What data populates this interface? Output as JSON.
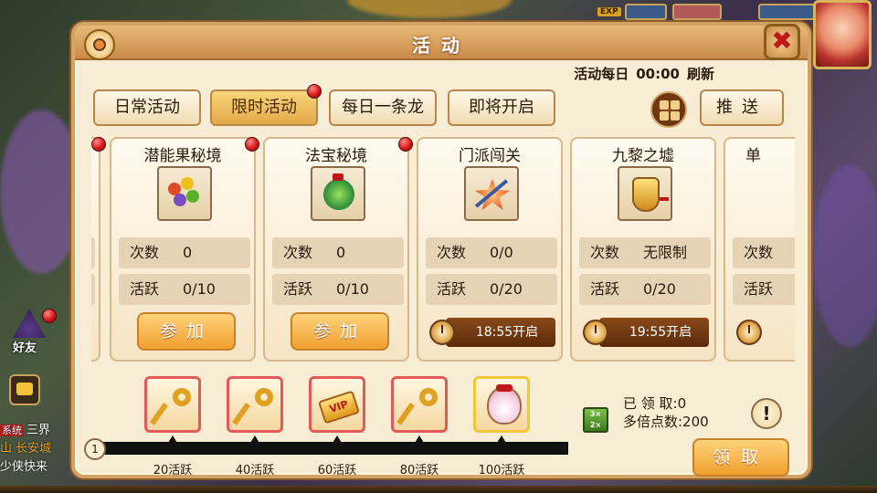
{
  "panel": {
    "title": "活动",
    "refresh_label": "活动每日",
    "refresh_time": "00:00",
    "refresh_suffix": "刷新",
    "close_glyph": "✖"
  },
  "tabs": [
    {
      "label": "日常活动",
      "active": false,
      "has_dot": false
    },
    {
      "label": "限时活动",
      "active": true,
      "has_dot": true
    },
    {
      "label": "每日一条龙",
      "active": false,
      "has_dot": false
    },
    {
      "label": "即将开启",
      "active": false,
      "has_dot": false
    }
  ],
  "push_label": "推送",
  "cards": [
    {
      "title": "潜能果秘境",
      "icon": "fruit-icon",
      "count_label": "次数",
      "count_value": "0",
      "active_label": "活跃",
      "active_value": "0/10",
      "action": "参加",
      "status": "join",
      "has_dot": true
    },
    {
      "title": "法宝秘境",
      "icon": "treasure-icon",
      "count_label": "次数",
      "count_value": "0",
      "active_label": "活跃",
      "active_value": "0/10",
      "action": "参加",
      "status": "join",
      "has_dot": true
    },
    {
      "title": "门派闯关",
      "icon": "sword-icon",
      "count_label": "次数",
      "count_value": "0/0",
      "active_label": "活跃",
      "active_value": "0/20",
      "action": "18:55开启",
      "status": "scheduled",
      "has_dot": false
    },
    {
      "title": "九黎之墟",
      "icon": "token-icon",
      "count_label": "次数",
      "count_value": "无限制",
      "active_label": "活跃",
      "active_value": "0/20",
      "action": "19:55开启",
      "status": "scheduled",
      "has_dot": false
    },
    {
      "title": "单",
      "icon": "",
      "count_label": "次数",
      "count_value": "",
      "active_label": "活跃",
      "active_value": "",
      "action": "",
      "status": "scheduled",
      "has_dot": false
    }
  ],
  "rewards": {
    "track_start": "1",
    "tiers": [
      {
        "label": "20活跃",
        "icon": "key-icon"
      },
      {
        "label": "40活跃",
        "icon": "key-icon"
      },
      {
        "label": "60活跃",
        "icon": "vip-card-icon"
      },
      {
        "label": "80活跃",
        "icon": "key-icon"
      },
      {
        "label": "100活跃",
        "icon": "lucky-bag-icon"
      }
    ],
    "claimed_label": "已 领 取:0",
    "multiplier_label": "多倍点数:200",
    "claim_label": "领取",
    "info_glyph": "!",
    "vip_text": "VIP"
  },
  "hud": {
    "exp_tag": "EXP",
    "friend_label": "好友",
    "chat_system_tag": "系统",
    "chat_line1": "三界",
    "chat_line2": "山 长安城",
    "chat_line3": "少侠快来"
  }
}
